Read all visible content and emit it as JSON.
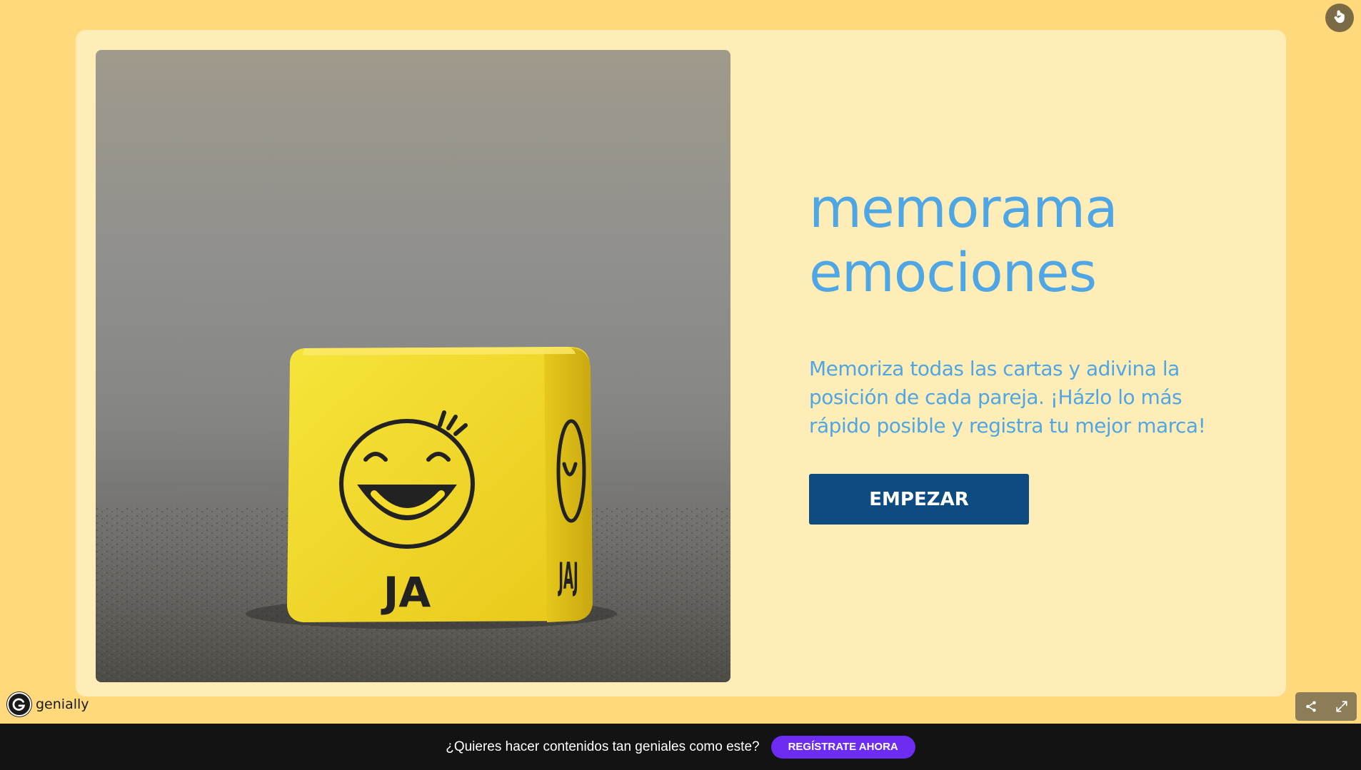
{
  "title_lines": [
    "memorama",
    "emociones"
  ],
  "subtitle_lines": [
    "Memoriza todas las cartas y adivina la",
    "posición de cada pareja. ¡Házlo lo más",
    "rápido posible y registra tu mejor marca!"
  ],
  "start_button": "EMPEZAR",
  "image": {
    "front_label": "JA",
    "side_label": "JAJ"
  },
  "brand": {
    "name": "genially"
  },
  "footer": {
    "prompt": "¿Quieres hacer contenidos tan geniales como este?",
    "register_button": "REGÍSTRATE AHORA"
  },
  "colors": {
    "page_background": "#ffd97c",
    "card_background": "#ffedb8",
    "title_color": "#4fa6e4",
    "button_color": "#0d4b80",
    "footer_background": "#131313",
    "register_color": "#6d2cf2"
  },
  "icons": [
    "hand-pointer-icon",
    "share-icon",
    "fullscreen-icon",
    "genially-logo-icon",
    "smiley-face-icon"
  ]
}
